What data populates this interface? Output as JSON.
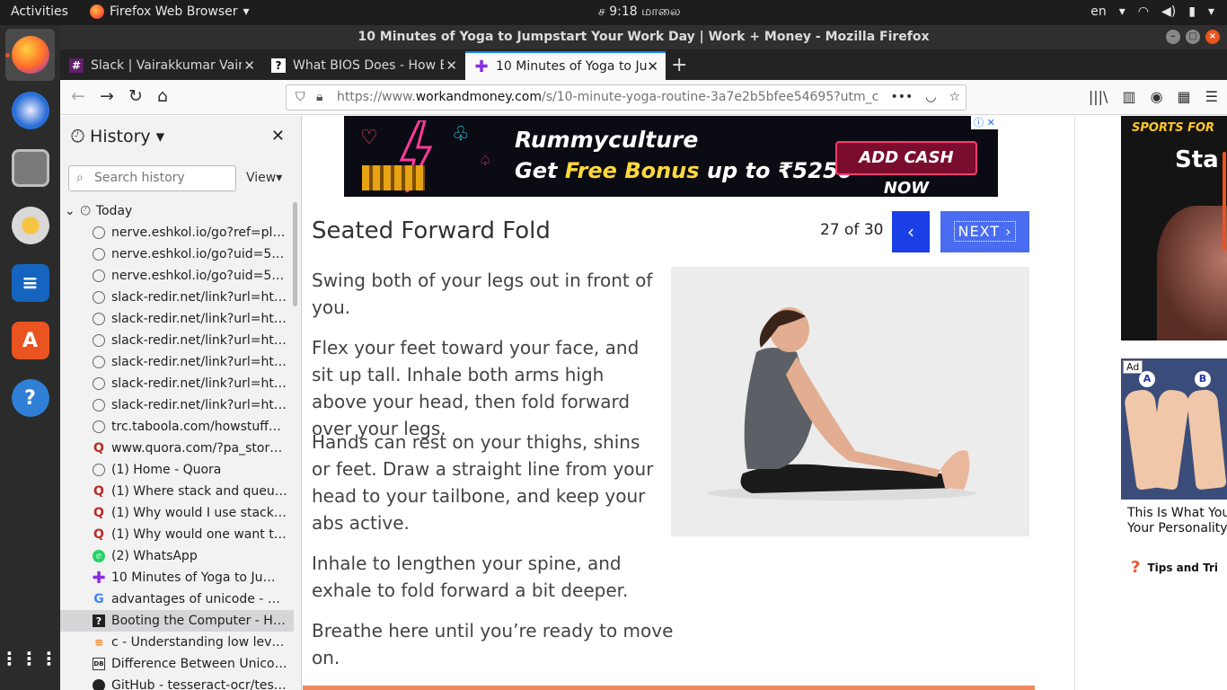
{
  "topbar": {
    "activities": "Activities",
    "app_name": "Firefox Web Browser",
    "clock": "ச  9:18 மாலை",
    "lang": "en"
  },
  "window": {
    "title": "10 Minutes of Yoga to Jumpstart Your Work Day | Work + Money - Mozilla Firefox"
  },
  "tabs": [
    {
      "label": "Slack | Vairakkumar Vaira",
      "icon": "slack-icon"
    },
    {
      "label": "What BIOS Does - How B",
      "icon": "hsw-icon"
    },
    {
      "label": "10 Minutes of Yoga to Ju",
      "icon": "plus-icon",
      "active": true
    }
  ],
  "urlbar": {
    "prefix": "https://www.",
    "domain": "workandmoney.com",
    "path": "/s/10-minute-yoga-routine-3a7e2b5bfee54695?utm_c"
  },
  "sidebar": {
    "title": "History",
    "search_placeholder": "Search history",
    "view_label": "View",
    "group": "Today",
    "items": [
      {
        "label": "nerve.eshkol.io/go?ref=pl&h...",
        "icon": "globe"
      },
      {
        "label": "nerve.eshkol.io/go?uid=5e1...",
        "icon": "globe"
      },
      {
        "label": "nerve.eshkol.io/go?uid=5e1...",
        "icon": "globe"
      },
      {
        "label": "slack-redir.net/link?url=http...",
        "icon": "globe"
      },
      {
        "label": "slack-redir.net/link?url=http...",
        "icon": "globe"
      },
      {
        "label": "slack-redir.net/link?url=http...",
        "icon": "globe"
      },
      {
        "label": "slack-redir.net/link?url=http...",
        "icon": "globe"
      },
      {
        "label": "slack-redir.net/link?url=http...",
        "icon": "globe"
      },
      {
        "label": "slack-redir.net/link?url=http...",
        "icon": "globe"
      },
      {
        "label": "trc.taboola.com/howstuffwo...",
        "icon": "globe"
      },
      {
        "label": "www.quora.com/?pa_story=...",
        "icon": "quora"
      },
      {
        "label": "(1) Home - Quora",
        "icon": "globe"
      },
      {
        "label": "(1) Where stack and queue u...",
        "icon": "quora"
      },
      {
        "label": "(1) Why would I use stack ins...",
        "icon": "quora"
      },
      {
        "label": "(1) Why would one want to u...",
        "icon": "quora"
      },
      {
        "label": "(2) WhatsApp",
        "icon": "wa"
      },
      {
        "label": "10 Minutes of Yoga to Jump...",
        "icon": "plus"
      },
      {
        "label": "advantages of unicode - Goo...",
        "icon": "g"
      },
      {
        "label": "Booting the Computer - How...",
        "icon": "hsw",
        "selected": true
      },
      {
        "label": "c - Understanding low level f...",
        "icon": "so"
      },
      {
        "label": "Difference Between Unicod...",
        "icon": "db"
      },
      {
        "label": "GitHub - tesseract-ocr/tessd...",
        "icon": "gh"
      }
    ]
  },
  "ad_banner": {
    "brand": "Rummyculture",
    "line_a": "Get ",
    "line_b": "Free Bonus",
    "line_c": " up to ₹5250",
    "cta": "ADD CASH NOW",
    "x": "ⓘ ✕"
  },
  "article": {
    "title": "Seated Forward Fold",
    "counter": "27 of 30",
    "prev": "‹",
    "next": "NEXT ›",
    "paragraphs": [
      "Swing both of your legs out in front of you.",
      "Flex your feet toward your face, and sit up tall. Inhale both arms high above your head, then fold forward over your legs.",
      "Hands can rest on your thighs, shins or feet. Draw a straight line from your head to your tailbone, and keep your abs active.",
      "Inhale to lengthen your spine, and exhale to fold forward a bit deeper.",
      "Breathe here until you’re ready to move on."
    ]
  },
  "side_ads": {
    "ad1_top": "SPORTS FOR",
    "ad1_big": "Sta",
    "ad_tag": "Ad",
    "label_a": "A",
    "label_b": "B",
    "caption_1": "This Is What You",
    "caption_2": "Your Personality",
    "brand": "Tips and Tri"
  }
}
